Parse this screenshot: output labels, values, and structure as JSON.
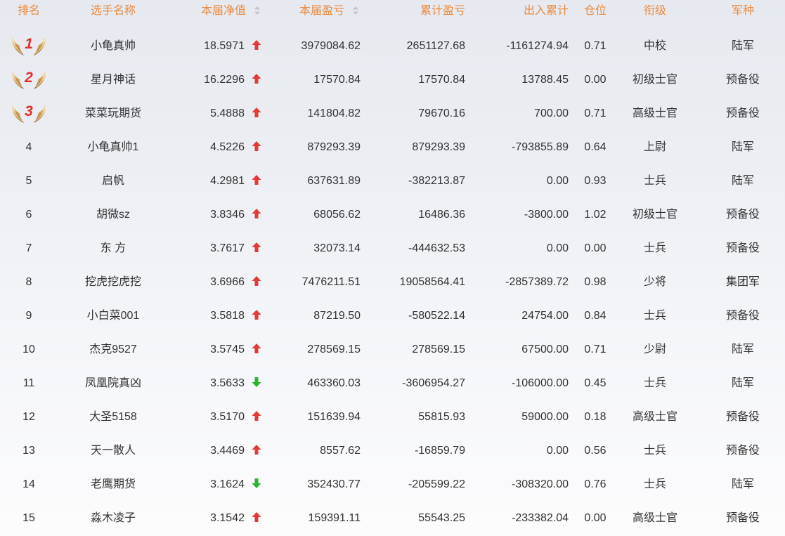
{
  "columns": [
    {
      "label": "排名",
      "sortable": false
    },
    {
      "label": "选手名称",
      "sortable": false
    },
    {
      "label": "本届净值",
      "sortable": true
    },
    {
      "label": "本届盈亏",
      "sortable": true
    },
    {
      "label": "累计盈亏",
      "sortable": false
    },
    {
      "label": "出入累计",
      "sortable": false
    },
    {
      "label": "仓位",
      "sortable": false
    },
    {
      "label": "衔级",
      "sortable": false
    },
    {
      "label": "军种",
      "sortable": false
    }
  ],
  "rows": [
    {
      "rank": "1",
      "rank_icon": "laurel-wings-icon",
      "name": "小龟真帅",
      "net_value": "18.5971",
      "trend_icon": "arrow-up-icon",
      "period_pnl": "3979084.62",
      "total_pnl": "2651127.68",
      "net_flow": "-1161274.94",
      "position": "0.71",
      "rank_title": "中校",
      "branch": "陆军"
    },
    {
      "rank": "2",
      "rank_icon": "laurel-wings-icon",
      "name": "星月神话",
      "net_value": "16.2296",
      "trend_icon": "arrow-up-icon",
      "period_pnl": "17570.84",
      "total_pnl": "17570.84",
      "net_flow": "13788.45",
      "position": "0.00",
      "rank_title": "初级士官",
      "branch": "预备役"
    },
    {
      "rank": "3",
      "rank_icon": "laurel-wings-icon",
      "name": "菜菜玩期货",
      "net_value": "5.4888",
      "trend_icon": "arrow-up-icon",
      "period_pnl": "141804.82",
      "total_pnl": "79670.16",
      "net_flow": "700.00",
      "position": "0.71",
      "rank_title": "高级士官",
      "branch": "预备役"
    },
    {
      "rank": "4",
      "rank_icon": null,
      "name": "小龟真帅1",
      "net_value": "4.5226",
      "trend_icon": "arrow-up-icon",
      "period_pnl": "879293.39",
      "total_pnl": "879293.39",
      "net_flow": "-793855.89",
      "position": "0.64",
      "rank_title": "上尉",
      "branch": "陆军"
    },
    {
      "rank": "5",
      "rank_icon": null,
      "name": "启帆",
      "net_value": "4.2981",
      "trend_icon": "arrow-up-icon",
      "period_pnl": "637631.89",
      "total_pnl": "-382213.87",
      "net_flow": "0.00",
      "position": "0.93",
      "rank_title": "士兵",
      "branch": "陆军"
    },
    {
      "rank": "6",
      "rank_icon": null,
      "name": "胡微sz",
      "net_value": "3.8346",
      "trend_icon": "arrow-up-icon",
      "period_pnl": "68056.62",
      "total_pnl": "16486.36",
      "net_flow": "-3800.00",
      "position": "1.02",
      "rank_title": "初级士官",
      "branch": "预备役"
    },
    {
      "rank": "7",
      "rank_icon": null,
      "name": "东 方",
      "net_value": "3.7617",
      "trend_icon": "arrow-up-icon",
      "period_pnl": "32073.14",
      "total_pnl": "-444632.53",
      "net_flow": "0.00",
      "position": "0.00",
      "rank_title": "士兵",
      "branch": "预备役"
    },
    {
      "rank": "8",
      "rank_icon": null,
      "name": "挖虎挖虎挖",
      "net_value": "3.6966",
      "trend_icon": "arrow-up-icon",
      "period_pnl": "7476211.51",
      "total_pnl": "19058564.41",
      "net_flow": "-2857389.72",
      "position": "0.98",
      "rank_title": "少将",
      "branch": "集团军"
    },
    {
      "rank": "9",
      "rank_icon": null,
      "name": "小白菜001",
      "net_value": "3.5818",
      "trend_icon": "arrow-up-icon",
      "period_pnl": "87219.50",
      "total_pnl": "-580522.14",
      "net_flow": "24754.00",
      "position": "0.84",
      "rank_title": "士兵",
      "branch": "预备役"
    },
    {
      "rank": "10",
      "rank_icon": null,
      "name": "杰克9527",
      "net_value": "3.5745",
      "trend_icon": "arrow-up-icon",
      "period_pnl": "278569.15",
      "total_pnl": "278569.15",
      "net_flow": "67500.00",
      "position": "0.71",
      "rank_title": "少尉",
      "branch": "陆军"
    },
    {
      "rank": "11",
      "rank_icon": null,
      "name": "凤凰院真凶",
      "net_value": "3.5633",
      "trend_icon": "arrow-down-icon",
      "period_pnl": "463360.03",
      "total_pnl": "-3606954.27",
      "net_flow": "-106000.00",
      "position": "0.45",
      "rank_title": "士兵",
      "branch": "陆军"
    },
    {
      "rank": "12",
      "rank_icon": null,
      "name": "大圣5158",
      "net_value": "3.5170",
      "trend_icon": "arrow-up-icon",
      "period_pnl": "151639.94",
      "total_pnl": "55815.93",
      "net_flow": "59000.00",
      "position": "0.18",
      "rank_title": "高级士官",
      "branch": "预备役"
    },
    {
      "rank": "13",
      "rank_icon": null,
      "name": "天一散人",
      "net_value": "3.4469",
      "trend_icon": "arrow-up-icon",
      "period_pnl": "8557.62",
      "total_pnl": "-16859.79",
      "net_flow": "0.00",
      "position": "0.56",
      "rank_title": "士兵",
      "branch": "预备役"
    },
    {
      "rank": "14",
      "rank_icon": null,
      "name": "老鹰期货",
      "net_value": "3.1624",
      "trend_icon": "arrow-down-icon",
      "period_pnl": "352430.77",
      "total_pnl": "-205599.22",
      "net_flow": "-308320.00",
      "position": "0.76",
      "rank_title": "士兵",
      "branch": "陆军"
    },
    {
      "rank": "15",
      "rank_icon": null,
      "name": "淼木凌子",
      "net_value": "3.1542",
      "trend_icon": "arrow-up-icon",
      "period_pnl": "159391.11",
      "total_pnl": "55543.25",
      "net_flow": "-233382.04",
      "position": "0.00",
      "rank_title": "高级士官",
      "branch": "预备役"
    }
  ],
  "colors": {
    "header_text": "#eb8a3f",
    "text": "#333333",
    "up": "#e53935",
    "down": "#2bb52b",
    "medal_number": "#e0302a"
  }
}
